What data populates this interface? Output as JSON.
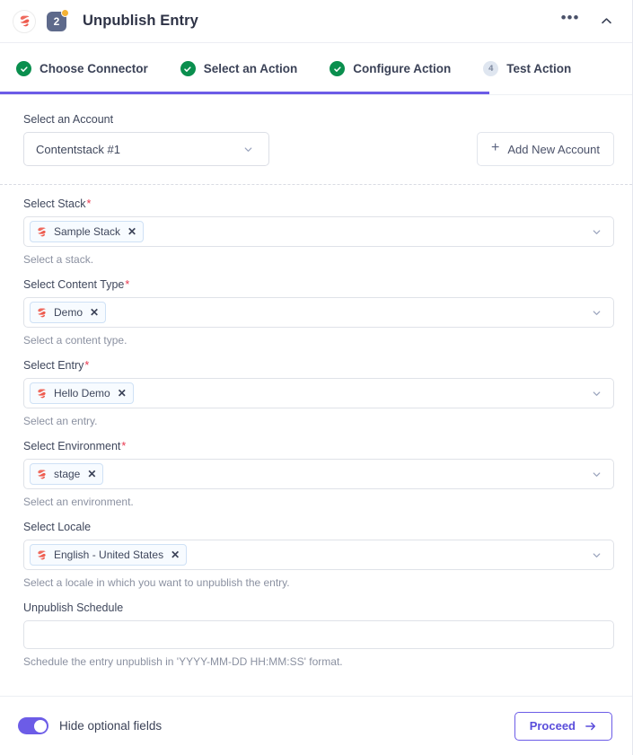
{
  "header": {
    "logo_icon": "contentstack-logo-icon",
    "step_number": "2",
    "title": "Unpublish Entry",
    "more_label": "•••",
    "collapse_icon": "chevron-up-icon"
  },
  "stepper": {
    "steps": [
      {
        "label": "Choose Connector",
        "state": "done",
        "marker": "✓"
      },
      {
        "label": "Select an Action",
        "state": "done",
        "marker": "✓"
      },
      {
        "label": "Configure Action",
        "state": "done",
        "marker": "✓"
      },
      {
        "label": "Test Action",
        "state": "pending",
        "marker": "4"
      }
    ],
    "progress_color": "#6c5ce7",
    "done_color": "#0a8f4e"
  },
  "account": {
    "label": "Select an Account",
    "selected": "Contentstack #1",
    "add_button": "Add New Account",
    "plus_icon": "plus-icon",
    "caret_icon": "chevron-down-icon"
  },
  "fields": [
    {
      "label": "Select Stack",
      "required": true,
      "chip": "Sample Stack",
      "chip_icon": "contentstack-logo-icon",
      "remove_icon": "✕",
      "hint": "Select a stack."
    },
    {
      "label": "Select Content Type",
      "required": true,
      "chip": "Demo",
      "chip_icon": "contentstack-logo-icon",
      "remove_icon": "✕",
      "hint": "Select a content type."
    },
    {
      "label": "Select Entry",
      "required": true,
      "chip": "Hello Demo",
      "chip_icon": "contentstack-logo-icon",
      "remove_icon": "✕",
      "hint": "Select an entry."
    },
    {
      "label": "Select Environment",
      "required": true,
      "chip": "stage",
      "chip_icon": "contentstack-logo-icon",
      "remove_icon": "✕",
      "hint": "Select an environment."
    },
    {
      "label": "Select Locale",
      "required": false,
      "chip": "English - United States",
      "chip_icon": "contentstack-logo-icon",
      "remove_icon": "✕",
      "hint": "Select a locale in which you want to unpublish the entry."
    }
  ],
  "schedule": {
    "label": "Unpublish Schedule",
    "required": false,
    "value": "",
    "placeholder": "",
    "hint": "Schedule the entry unpublish in 'YYYY-MM-DD HH:MM:SS' format."
  },
  "footer": {
    "toggle_label": "Hide optional fields",
    "toggle_on": true,
    "toggle_color": "#6c5ce7",
    "proceed_label": "Proceed",
    "proceed_icon": "arrow-right-icon"
  }
}
